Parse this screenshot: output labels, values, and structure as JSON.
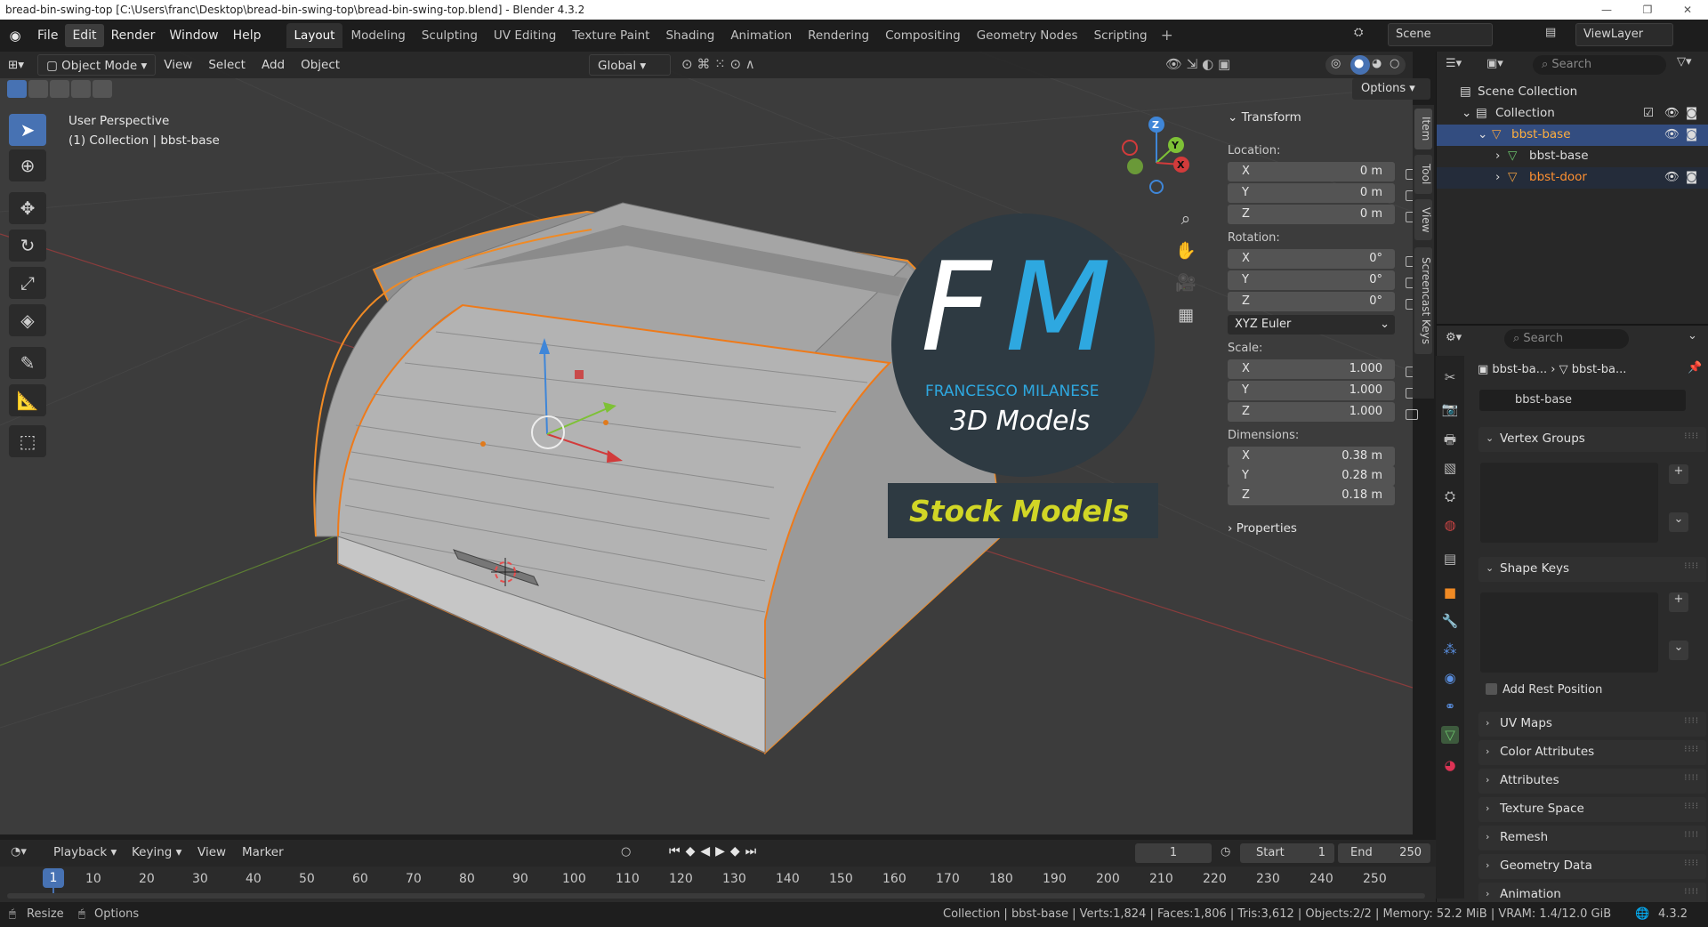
{
  "window": {
    "title": "bread-bin-swing-top [C:\\Users\\franc\\Desktop\\bread-bin-swing-top\\bread-bin-swing-top.blend] - Blender 4.3.2",
    "min": "—",
    "max": "❐",
    "close": "✕"
  },
  "menus": [
    "File",
    "Edit",
    "Render",
    "Window",
    "Help"
  ],
  "workspaces": [
    "Layout",
    "Modeling",
    "Sculpting",
    "UV Editing",
    "Texture Paint",
    "Shading",
    "Animation",
    "Rendering",
    "Compositing",
    "Geometry Nodes",
    "Scripting"
  ],
  "scene": "Scene",
  "view_layer": "ViewLayer",
  "viewport_header": {
    "mode": "Object Mode",
    "view": "View",
    "select": "Select",
    "add": "Add",
    "object": "Object",
    "orientation": "Global",
    "options": "Options"
  },
  "viewport": {
    "perspective": "User Perspective",
    "collection": "(1) Collection | bbst-base"
  },
  "logo": {
    "initials_f": "F",
    "initials_m": "M",
    "name": "FRANCESCO MILANESE",
    "subtitle": "3D Models",
    "banner": "Stock Models"
  },
  "gizmo": {
    "x": "X",
    "y": "Y",
    "z": "Z"
  },
  "npanel": {
    "header": "Transform",
    "location": "Location:",
    "rotation": "Rotation:",
    "scale": "Scale:",
    "dimensions": "Dimensions:",
    "euler": "XYZ Euler",
    "properties": "Properties",
    "loc": [
      {
        "k": "X",
        "v": "0 m"
      },
      {
        "k": "Y",
        "v": "0 m"
      },
      {
        "k": "Z",
        "v": "0 m"
      }
    ],
    "rot": [
      {
        "k": "X",
        "v": "0°"
      },
      {
        "k": "Y",
        "v": "0°"
      },
      {
        "k": "Z",
        "v": "0°"
      }
    ],
    "scl": [
      {
        "k": "X",
        "v": "1.000"
      },
      {
        "k": "Y",
        "v": "1.000"
      },
      {
        "k": "Z",
        "v": "1.000"
      }
    ],
    "dim": [
      {
        "k": "X",
        "v": "0.38 m"
      },
      {
        "k": "Y",
        "v": "0.28 m"
      },
      {
        "k": "Z",
        "v": "0.18 m"
      }
    ],
    "tabs": [
      "Item",
      "Tool",
      "View",
      "Screencast Keys"
    ]
  },
  "outliner": {
    "search": "Search",
    "scene_collection": "Scene Collection",
    "collection": "Collection",
    "base": "bbst-base",
    "mesh": "bbst-base",
    "door": "bbst-door"
  },
  "props": {
    "search": "Search",
    "crumb1": "bbst-ba...",
    "crumb2": "bbst-ba...",
    "mesh_name": "bbst-base",
    "vertex_groups": "Vertex Groups",
    "shape_keys": "Shape Keys",
    "add_rest": "Add Rest Position",
    "uv": "UV Maps",
    "color": "Color Attributes",
    "attrs": "Attributes",
    "texspace": "Texture Space",
    "remesh": "Remesh",
    "geo": "Geometry Data",
    "anim": "Animation"
  },
  "timeline": {
    "playback": "Playback",
    "keying": "Keying",
    "view": "View",
    "marker": "Marker",
    "frame": "1",
    "start_label": "Start",
    "start": "1",
    "end_label": "End",
    "end": "250",
    "current": "1",
    "ticks": [
      "10",
      "20",
      "30",
      "40",
      "50",
      "60",
      "70",
      "80",
      "90",
      "100",
      "110",
      "120",
      "130",
      "140",
      "150",
      "160",
      "170",
      "180",
      "190",
      "200",
      "210",
      "220",
      "230",
      "240",
      "250"
    ]
  },
  "status": {
    "resize": "Resize",
    "options": "Options",
    "stats": "Collection | bbst-base | Verts:1,824 | Faces:1,806 | Tris:3,612 | Objects:2/2 | Memory: 52.2 MiB | VRAM: 1.4/12.0 GiB",
    "version": "4.3.2"
  }
}
